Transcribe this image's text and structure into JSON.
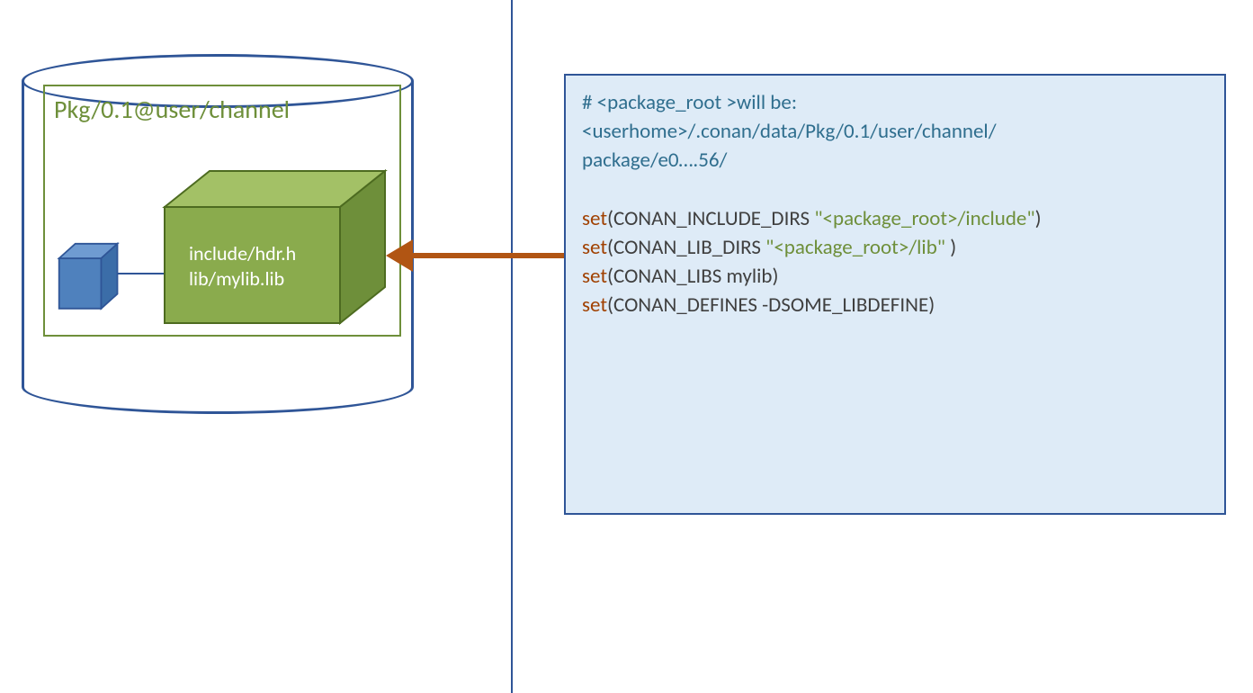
{
  "colors": {
    "blue": "#2f5597",
    "green": "#6e8f3a",
    "orange": "#b15513",
    "panel": "#deebf7",
    "comment": "#2f6e8e",
    "keyword": "#a04000"
  },
  "package": {
    "ref": "Pkg/0.1@user/channel",
    "files": {
      "line1": "include/hdr.h",
      "line2": "lib/mylib.lib"
    }
  },
  "code": {
    "comment_l1": "# <package_root >will be:",
    "comment_l2": "<userhome>/.conan/data/Pkg/0.1/user/channel/",
    "comment_l3": "package/e0….56/",
    "set": "set",
    "l1_a": "(CONAN_INCLUDE_DIRS ",
    "l1_str": "\"<package_root>/include\"",
    "l1_b": ")",
    "l2_a": "(CONAN_LIB_DIRS   ",
    "l2_str": "\"<package_root>/lib\"",
    "l2_b": " )",
    "l3": "(CONAN_LIBS mylib)",
    "l4": "(CONAN_DEFINES -DSOME_LIBDEFINE)"
  }
}
